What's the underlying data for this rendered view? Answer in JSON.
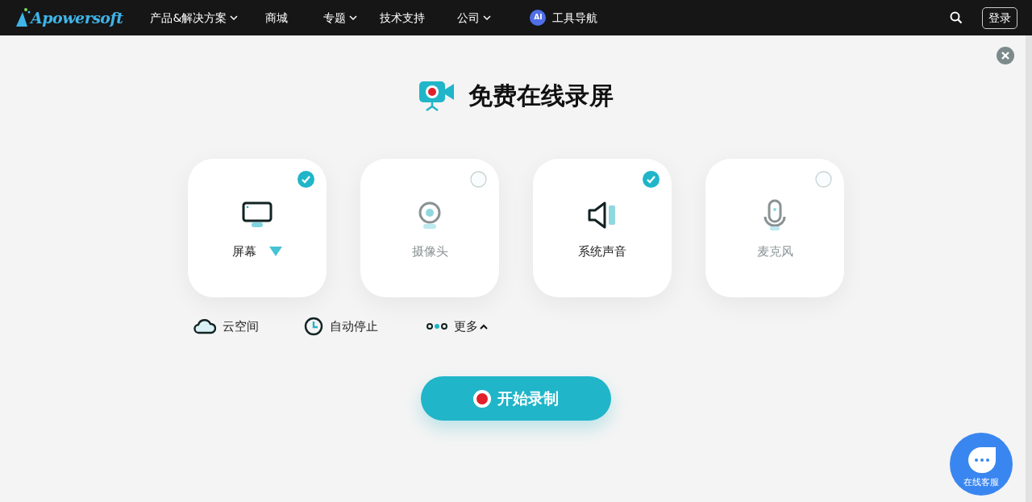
{
  "navbar": {
    "logo": "Apowersoft",
    "menu": [
      {
        "label": "产品&解决方案",
        "dropdown": true
      },
      {
        "label": "商城",
        "dropdown": false
      },
      {
        "label": "专题",
        "dropdown": true
      },
      {
        "label": "技术支持",
        "dropdown": false
      },
      {
        "label": "公司",
        "dropdown": true
      },
      {
        "label": "工具导航",
        "dropdown": false,
        "badge": "AI"
      }
    ],
    "login": "登录"
  },
  "title": "免费在线录屏",
  "sources": [
    {
      "kind": "screen",
      "label": "屏幕",
      "checked": true,
      "dropdown": true
    },
    {
      "kind": "camera",
      "label": "摄像头",
      "checked": false,
      "dropdown": false
    },
    {
      "kind": "speaker",
      "label": "系统声音",
      "checked": true,
      "dropdown": false
    },
    {
      "kind": "mic",
      "label": "麦克风",
      "checked": false,
      "dropdown": false
    }
  ],
  "options": [
    {
      "kind": "cloud",
      "label": "云空间"
    },
    {
      "kind": "timer",
      "label": "自动停止"
    },
    {
      "kind": "more",
      "label": "更多",
      "expanded": true
    }
  ],
  "start_button": "开始录制",
  "chat": {
    "label": "在线客服"
  }
}
